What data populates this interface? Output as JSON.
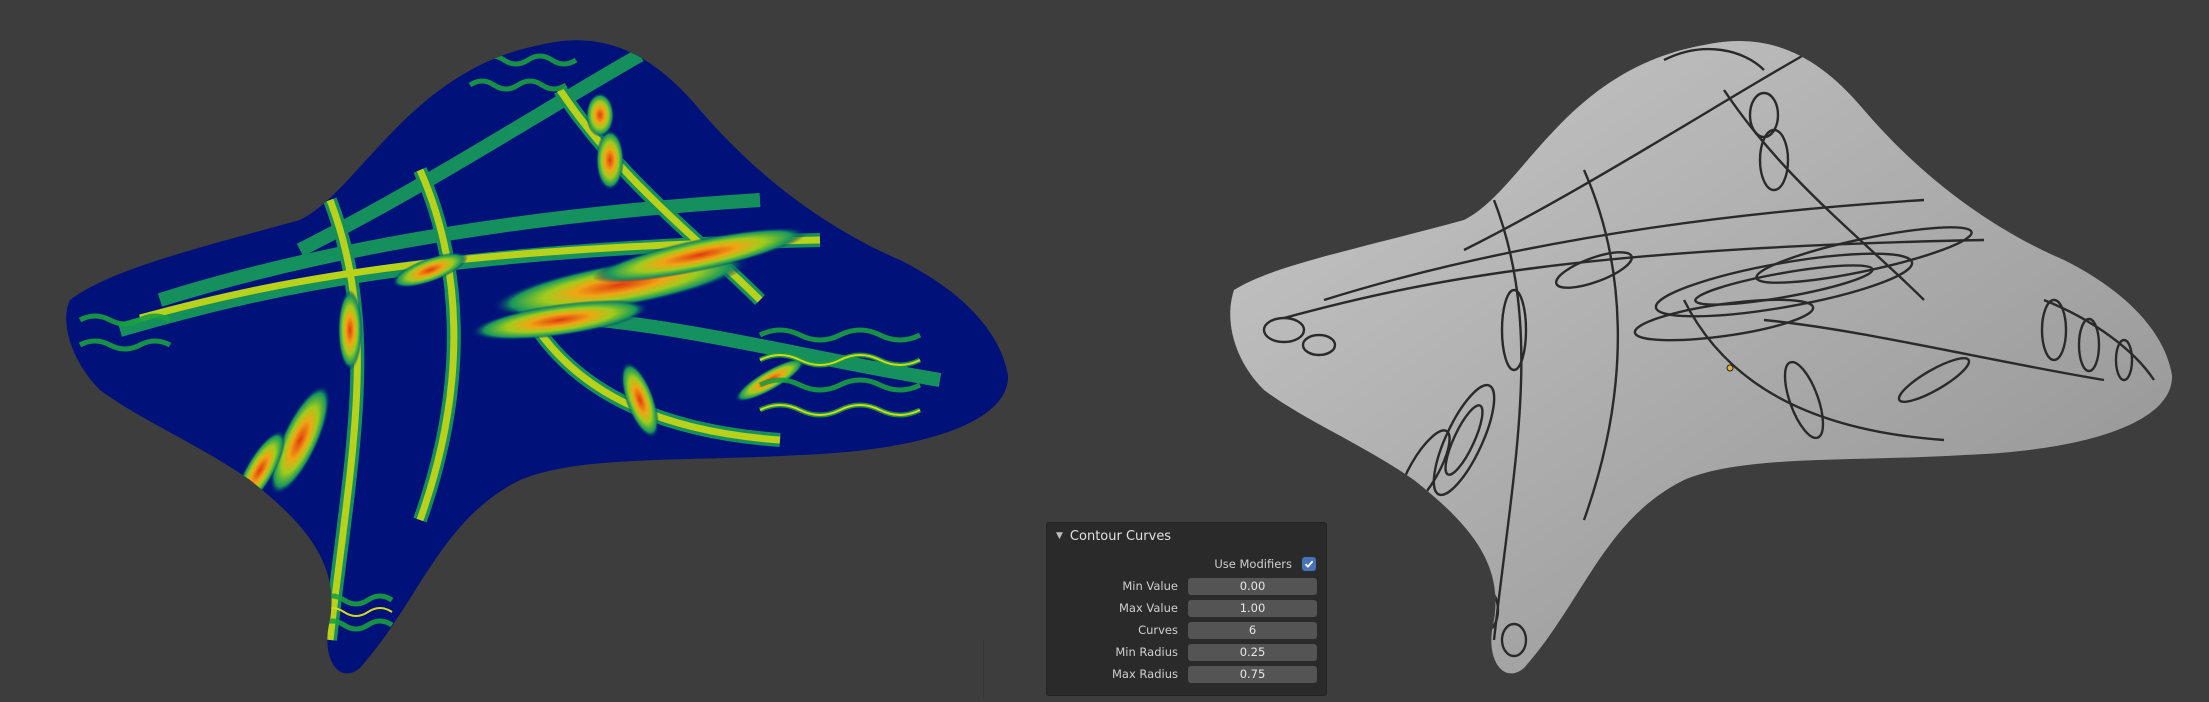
{
  "panel": {
    "title": "Contour Curves",
    "collapse_icon": "triangle-down-icon",
    "use_modifiers": {
      "label": "Use Modifiers",
      "checked": true
    },
    "fields": [
      {
        "label": "Min Value",
        "value": "0.00"
      },
      {
        "label": "Max Value",
        "value": "1.00"
      },
      {
        "label": "Curves",
        "value": "6"
      },
      {
        "label": "Min Radius",
        "value": "0.25"
      },
      {
        "label": "Max Radius",
        "value": "0.75"
      }
    ]
  },
  "colors": {
    "background": "#3d3d3d",
    "panel": "#2a2a2a",
    "field": "#545454",
    "accent": "#4772b3",
    "heatmap_low": "#00127a",
    "heatmap_mid": "#1aa040",
    "heatmap_high": "#e03a10",
    "contour_surface": "#a9a9a9",
    "contour_line": "#2a2a2a"
  }
}
